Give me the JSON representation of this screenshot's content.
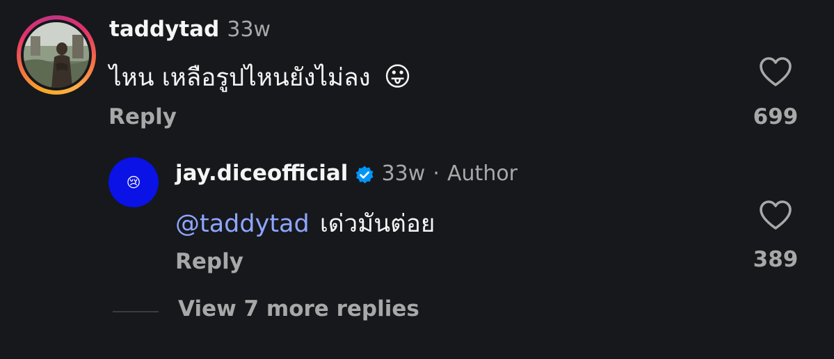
{
  "comments": [
    {
      "username": "taddytad",
      "time": "33w",
      "text": "ไหน เหลือรูปไหนยังไม่ลง",
      "emoji": "😛",
      "reply_label": "Reply",
      "likes": "699"
    }
  ],
  "reply": {
    "username": "jay.diceofficial",
    "time": "33w",
    "separator": "·",
    "author_label": "Author",
    "mention": "@taddytad",
    "text": "เด่วมันต่อย",
    "avatar_emoji": "😢",
    "reply_label": "Reply",
    "likes": "389"
  },
  "view_more": "View 7 more replies",
  "colors": {
    "background": "#16181c",
    "primary_text": "#f5f5f5",
    "secondary_text": "#a8a8a8",
    "mention": "#8fa6ff",
    "verified_badge": "#0095f6",
    "reply_avatar_bg": "#0a12e6"
  },
  "icons": {
    "like": "heart-outline-icon",
    "verified": "verified-badge-icon"
  }
}
